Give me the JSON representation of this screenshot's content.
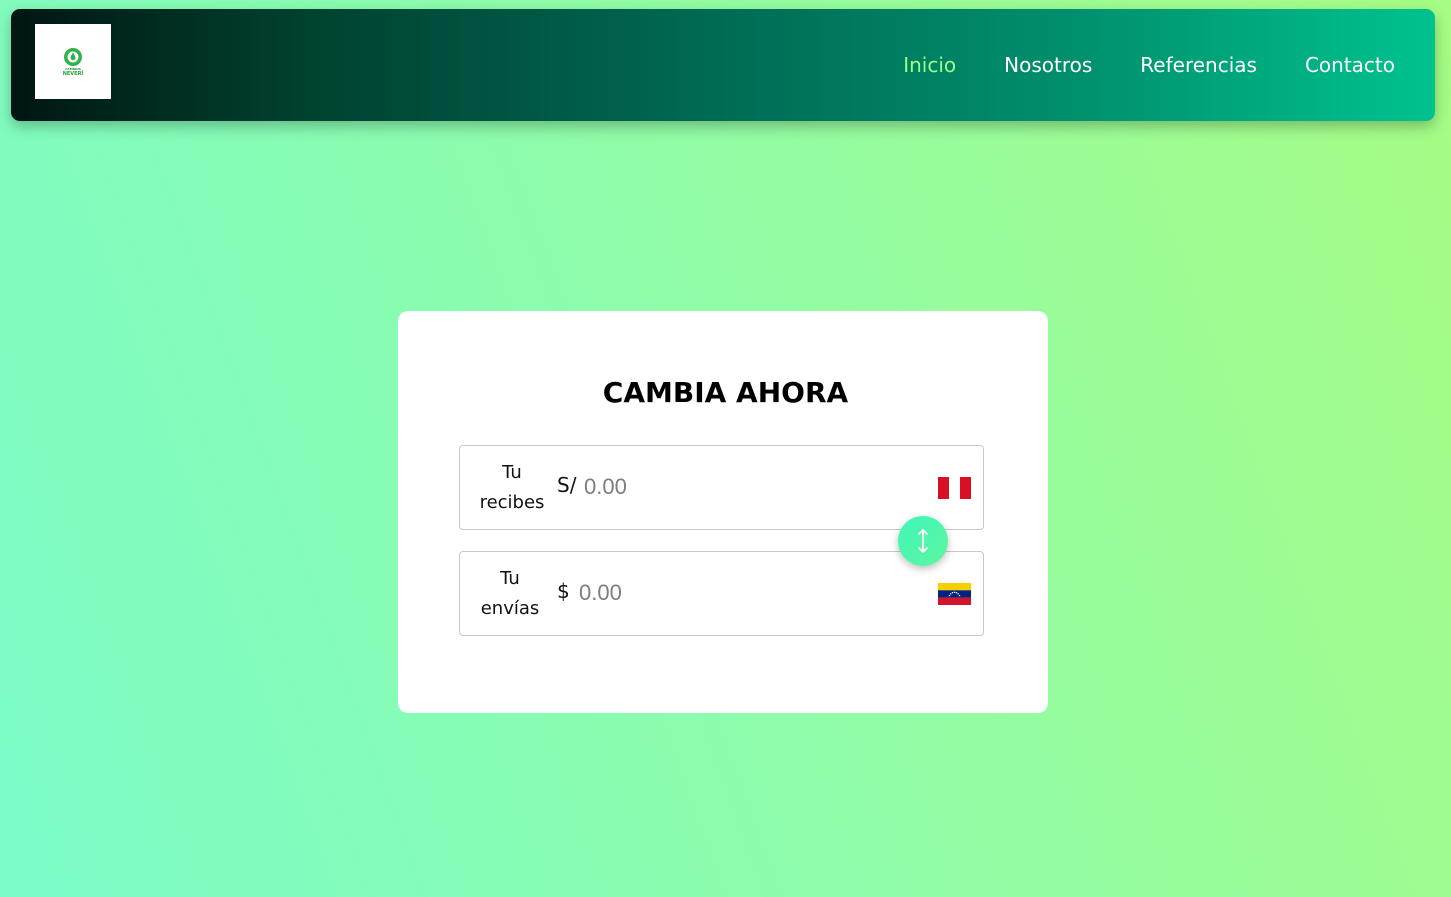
{
  "header": {
    "logo": {
      "brand_top": "CAMBIOS",
      "brand_main": "NEVERÍ"
    },
    "nav": [
      {
        "label": "Inicio",
        "active": true
      },
      {
        "label": "Nosotros",
        "active": false
      },
      {
        "label": "Referencias",
        "active": false
      },
      {
        "label": "Contacto",
        "active": false
      }
    ]
  },
  "exchange": {
    "title": "CAMBIA AHORA",
    "receive": {
      "label_line1": "Tu",
      "label_line2": "recibes",
      "currency": "S/",
      "placeholder": "0.00",
      "flag": "peru-flag"
    },
    "send": {
      "label_line1": "Tu",
      "label_line2": "envías",
      "currency": "$",
      "placeholder": "0.00",
      "flag": "venezuela-flag"
    },
    "swap_icon": "swap-vertical-icon"
  },
  "colors": {
    "accent": "#9cff86",
    "nav_text": "#ffffff",
    "swap_button": "#3ef7b9",
    "peru_red": "#d91023",
    "venezuela_yellow": "#f6cf00",
    "venezuela_blue": "#00247d",
    "venezuela_red": "#cf142b"
  }
}
